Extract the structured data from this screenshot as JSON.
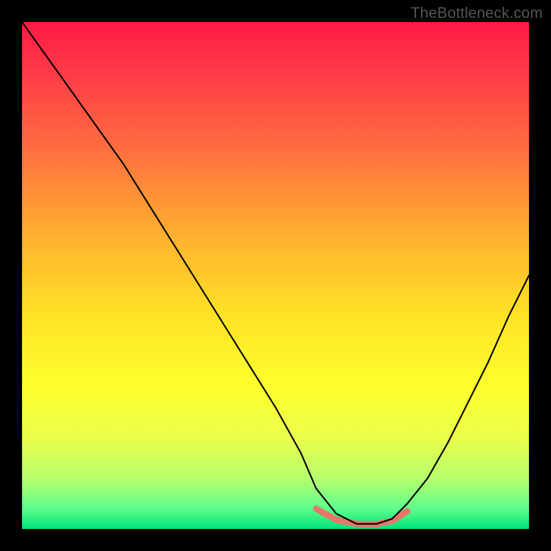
{
  "watermark": "TheBottleneck.com",
  "chart_data": {
    "type": "line",
    "title": "",
    "xlabel": "",
    "ylabel": "",
    "xlim": [
      0,
      100
    ],
    "ylim": [
      0,
      100
    ],
    "grid": false,
    "background_gradient": {
      "type": "vertical",
      "stops": [
        {
          "pos": 0.0,
          "color": "#ff1a45"
        },
        {
          "pos": 0.1,
          "color": "#ff3a47"
        },
        {
          "pos": 0.25,
          "color": "#ff6e3f"
        },
        {
          "pos": 0.42,
          "color": "#ffb02e"
        },
        {
          "pos": 0.58,
          "color": "#ffe326"
        },
        {
          "pos": 0.72,
          "color": "#feff2d"
        },
        {
          "pos": 0.82,
          "color": "#eaff4a"
        },
        {
          "pos": 0.9,
          "color": "#b6ff6e"
        },
        {
          "pos": 0.96,
          "color": "#5dff8c"
        },
        {
          "pos": 1.0,
          "color": "#00e27a"
        }
      ]
    },
    "series": [
      {
        "name": "bottleneck-curve",
        "color": "#000000",
        "stroke_width": 2.2,
        "x": [
          0,
          5,
          10,
          15,
          20,
          25,
          30,
          35,
          40,
          45,
          50,
          55,
          58,
          62,
          66,
          70,
          73,
          76,
          80,
          84,
          88,
          92,
          96,
          100
        ],
        "y": [
          100,
          93,
          86,
          79,
          72,
          64,
          56,
          48,
          40,
          32,
          24,
          15,
          8,
          3,
          1,
          1,
          2,
          5,
          10,
          17,
          25,
          33,
          42,
          50
        ]
      }
    ],
    "highlight": {
      "name": "valley-segment",
      "color": "#e9766b",
      "stroke_width": 9,
      "linecap": "round",
      "x": [
        58,
        62,
        66,
        70,
        73,
        76
      ],
      "y": [
        4,
        1.8,
        1,
        1,
        1.6,
        3.5
      ]
    }
  }
}
